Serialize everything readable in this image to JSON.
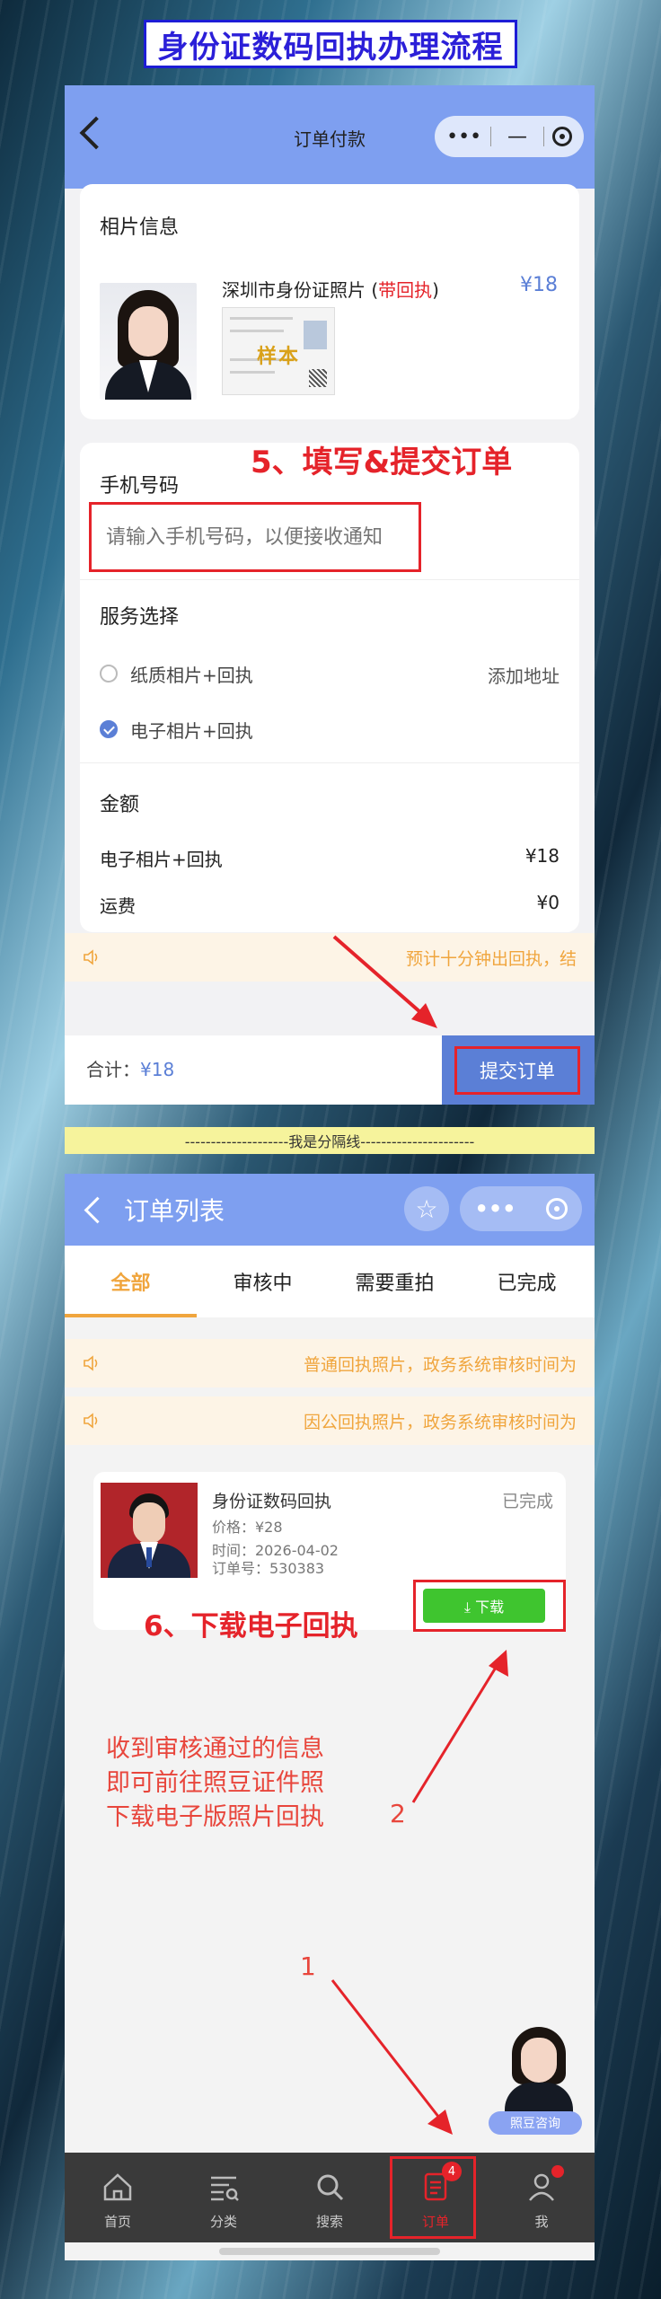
{
  "banner": {
    "title": "身份证数码回执办理流程"
  },
  "screen1": {
    "nav": {
      "title": "订单付款",
      "more": "•••"
    },
    "photo_section": {
      "title": "相片信息",
      "item_name": "深圳市身份证照片",
      "item_tag": "带回执",
      "price": "¥18",
      "sample_mark": "样本"
    },
    "step_label": "5、填写&提交订单",
    "phone": {
      "label": "手机号码",
      "placeholder": "请输入手机号码，以便接收通知"
    },
    "service": {
      "title": "服务选择",
      "options": [
        {
          "label": "纸质相片+回执",
          "checked": false
        },
        {
          "label": "电子相片+回执",
          "checked": true
        }
      ],
      "add_address": "添加地址"
    },
    "amount": {
      "title": "金额",
      "rows": [
        {
          "label": "电子相片+回执",
          "value": "¥18"
        },
        {
          "label": "运费",
          "value": "¥0"
        }
      ]
    },
    "notice": "预计十分钟出回执，结",
    "footer": {
      "total_label": "合计：",
      "total_value": "¥18",
      "submit": "提交订单"
    }
  },
  "separator": "--------------------我是分隔线----------------------",
  "screen2": {
    "nav": {
      "title": "订单列表",
      "more": "•••"
    },
    "tabs": [
      "全部",
      "审核中",
      "需要重拍",
      "已完成"
    ],
    "active_tab": 0,
    "notices": [
      "普通回执照片，政务系统审核时间为",
      "因公回执照片，政务系统审核时间为"
    ],
    "order": {
      "name": "身份证数码回执",
      "status": "已完成",
      "price": "价格：¥28",
      "time": "时间：2026-04-02",
      "order_no": "订单号：530383",
      "download": "⤓ 下载"
    },
    "step_label": "6、下载电子回执",
    "hint": [
      "收到审核通过的信息",
      "即可前往照豆证件照",
      "下载电子版照片回执"
    ],
    "annotations": {
      "one": "1",
      "two": "2"
    },
    "assistant": "照豆咨询",
    "tabbar": [
      {
        "label": "首页",
        "icon": "home-icon"
      },
      {
        "label": "分类",
        "icon": "category-icon"
      },
      {
        "label": "搜索",
        "icon": "search-icon"
      },
      {
        "label": "订单",
        "icon": "order-icon",
        "badge": "4"
      },
      {
        "label": "我",
        "icon": "user-icon"
      }
    ],
    "active_tabbar": 3
  },
  "colors": {
    "nav": "#7e9ff0",
    "accent": "#5b7fd6",
    "highlight": "#e5232a",
    "orange": "#f0a53d",
    "download": "#3fc52f"
  }
}
